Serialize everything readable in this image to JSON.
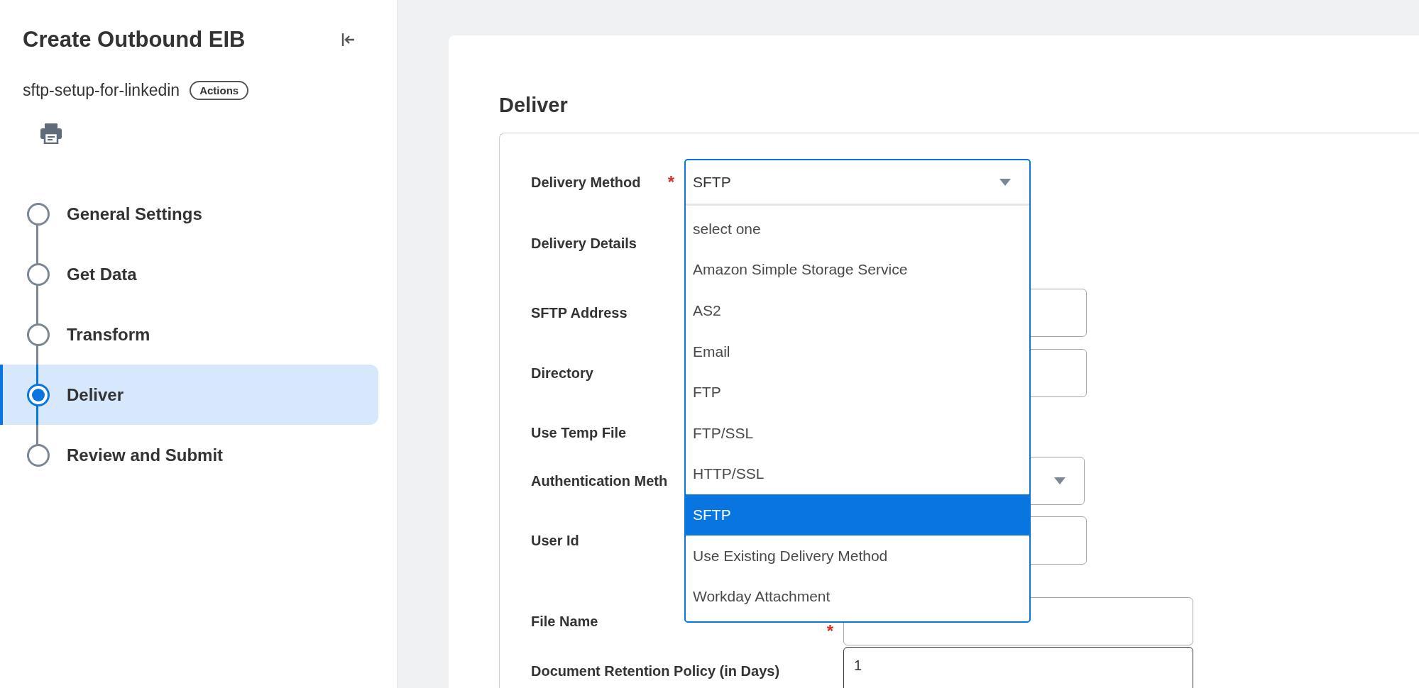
{
  "sidebar": {
    "title": "Create Outbound EIB",
    "subtitle": "sftp-setup-for-linkedin",
    "actions_button": "Actions",
    "steps": [
      {
        "label": "General Settings",
        "selected": false
      },
      {
        "label": "Get Data",
        "selected": false
      },
      {
        "label": "Transform",
        "selected": false
      },
      {
        "label": "Deliver",
        "selected": true
      },
      {
        "label": "Review and Submit",
        "selected": false
      }
    ]
  },
  "main": {
    "heading": "Deliver",
    "fields": [
      {
        "label": "Delivery Method",
        "kind": "combo",
        "required_mark": "*"
      },
      {
        "label": "Delivery Details",
        "kind": "heading"
      },
      {
        "label": "SFTP Address",
        "kind": "input"
      },
      {
        "label": "Directory",
        "kind": "input"
      },
      {
        "label": "Use Temp File",
        "kind": "plain"
      },
      {
        "label": "Authentication Meth",
        "kind": "select"
      },
      {
        "label": "User Id",
        "kind": "input"
      },
      {
        "label": "File Name",
        "kind": "input",
        "required_mark": "*"
      },
      {
        "label": "Document Retention Policy (in Days)",
        "kind": "input",
        "value": "1"
      }
    ],
    "delivery_method": {
      "value": "SFTP",
      "options": [
        {
          "label": "select one",
          "selected": false
        },
        {
          "label": "Amazon Simple Storage Service",
          "selected": false
        },
        {
          "label": "AS2",
          "selected": false
        },
        {
          "label": "Email",
          "selected": false
        },
        {
          "label": "FTP",
          "selected": false
        },
        {
          "label": "FTP/SSL",
          "selected": false
        },
        {
          "label": "HTTP/SSL",
          "selected": false
        },
        {
          "label": "SFTP",
          "selected": true
        },
        {
          "label": "Use Existing Delivery Method",
          "selected": false
        },
        {
          "label": "Workday Attachment",
          "selected": false
        }
      ]
    }
  }
}
